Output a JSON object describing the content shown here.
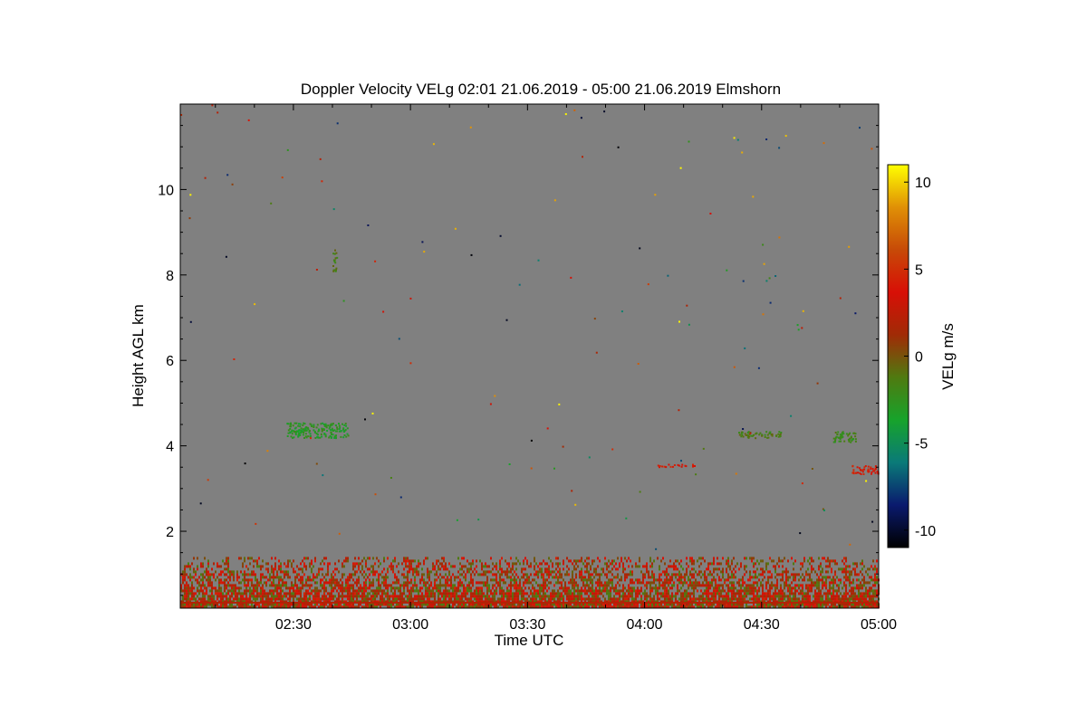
{
  "chart_data": {
    "type": "heatmap",
    "title": "Doppler Velocity VELg   02:01 21.06.2019 - 05:00 21.06.2019 Elmshorn",
    "xlabel": "Time UTC",
    "ylabel": "Height AGL km",
    "x_range": [
      "02:01",
      "05:00"
    ],
    "x_ticks": [
      "02:30",
      "03:00",
      "03:30",
      "04:00",
      "04:30",
      "05:00"
    ],
    "y_range": [
      0.2,
      12.0
    ],
    "y_ticks": [
      2,
      4,
      6,
      8,
      10
    ],
    "no_signal_color": "#808080",
    "colorbar": {
      "label": "VELg m/s",
      "range": [
        -11,
        11
      ],
      "ticks": [
        10,
        5,
        0,
        -5,
        -10
      ],
      "colors": [
        "#000000",
        "#0a1a6e",
        "#0a7a78",
        "#17a32b",
        "#4f7a10",
        "#a02b06",
        "#d80f06",
        "#c74a07",
        "#e09006",
        "#ffff00"
      ]
    },
    "features": [
      {
        "time_start": "02:01",
        "time_end": "05:00",
        "height_min": 0.2,
        "height_max": 1.4,
        "velocity": 1.5,
        "description_label": ""
      },
      {
        "time_start": "02:28",
        "time_end": "02:44",
        "height_min": 4.2,
        "height_max": 4.55,
        "velocity": -3
      },
      {
        "time_start": "02:40",
        "time_end": "02:41",
        "height_min": 8.1,
        "height_max": 8.6,
        "velocity": -1.5
      },
      {
        "time_start": "04:24",
        "time_end": "04:35",
        "height_min": 4.2,
        "height_max": 4.35,
        "velocity": -1.5
      },
      {
        "time_start": "04:48",
        "time_end": "04:54",
        "height_min": 4.1,
        "height_max": 4.35,
        "velocity": -2
      },
      {
        "time_start": "04:03",
        "time_end": "04:13",
        "height_min": 3.52,
        "height_max": 3.58,
        "velocity": 4
      },
      {
        "time_start": "04:53",
        "time_end": "05:00",
        "height_min": 3.35,
        "height_max": 3.55,
        "velocity": 4
      }
    ]
  }
}
